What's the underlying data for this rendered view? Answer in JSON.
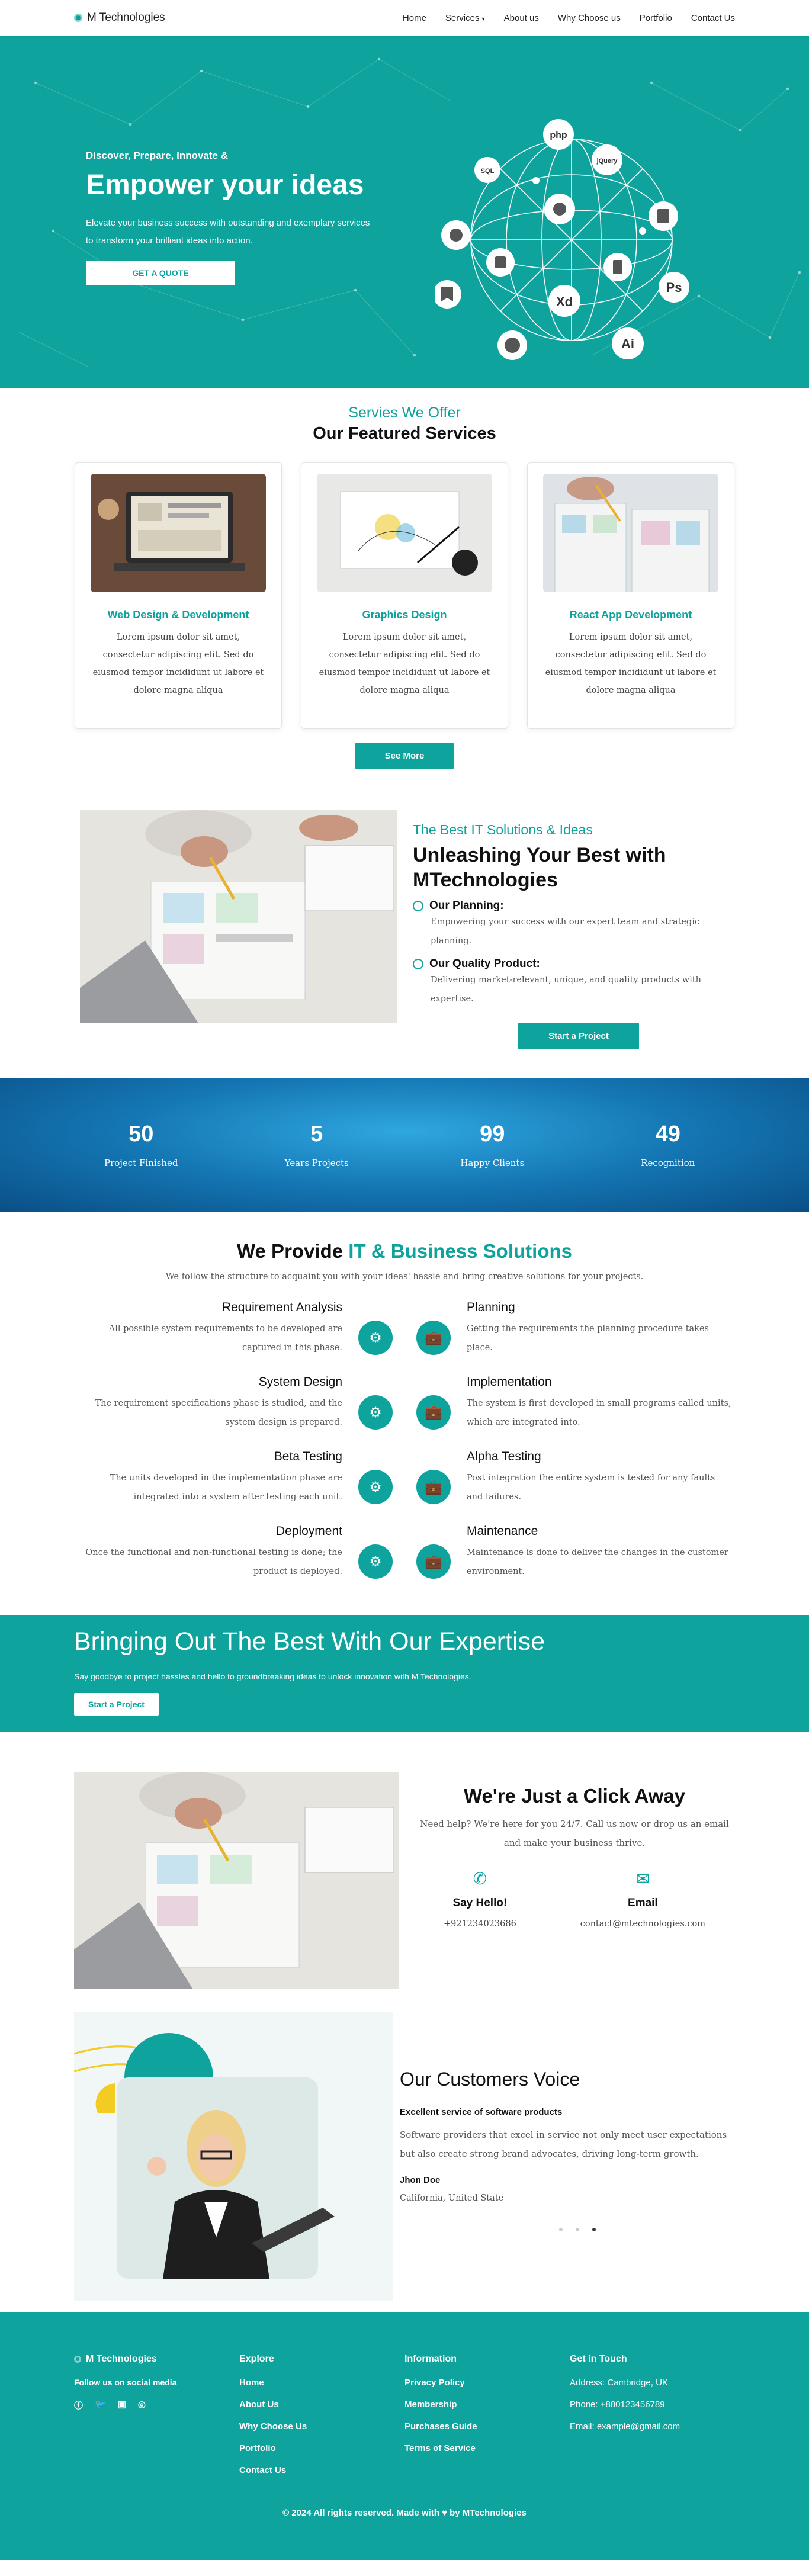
{
  "nav": {
    "brand": "M Technologies",
    "items": [
      "Home",
      "Services",
      "About us",
      "Why Choose us",
      "Portfolio",
      "Contact Us"
    ]
  },
  "hero": {
    "kicker": "Discover, Prepare, Innovate &",
    "title": "Empower your ideas",
    "desc": "Elevate your business success with outstanding and exemplary services to transform your brilliant ideas into action.",
    "cta": "GET A QUOTE",
    "tech_labels": [
      "php",
      "SQL",
      "jQuery",
      "Xd",
      "Ps",
      "Ai"
    ]
  },
  "services": {
    "kicker": "Servies We Offer",
    "title": "Our Featured Services",
    "cards": [
      {
        "title": "Web Design & Development",
        "desc": "Lorem ipsum dolor sit amet, consectetur adipiscing elit. Sed do eiusmod tempor incididunt ut labore et dolore magna aliqua"
      },
      {
        "title": "Graphics Design",
        "desc": "Lorem ipsum dolor sit amet, consectetur adipiscing elit. Sed do eiusmod tempor incididunt ut labore et dolore magna aliqua"
      },
      {
        "title": "React App Development",
        "desc": "Lorem ipsum dolor sit amet, consectetur adipiscing elit. Sed do eiusmod tempor incididunt ut labore et dolore magna aliqua"
      }
    ],
    "more": "See More"
  },
  "about": {
    "kicker": "The Best IT Solutions & Ideas",
    "title": "Unleashing Your Best with MTechnologies",
    "f1_title": "Our Planning:",
    "f1_desc": "Empowering your success with our expert team and strategic planning.",
    "f2_title": "Our Quality Product:",
    "f2_desc": "Delivering market-relevant, unique, and quality products with expertise.",
    "cta": "Start a Project"
  },
  "stats": [
    {
      "num": "50",
      "label": "Project Finished"
    },
    {
      "num": "5",
      "label": "Years Projects"
    },
    {
      "num": "99",
      "label": "Happy Clients"
    },
    {
      "num": "49",
      "label": "Recognition"
    }
  ],
  "provide": {
    "title_a": "We Provide ",
    "title_b": "IT & Business Solutions",
    "sub": "We follow the structure to acquaint you with your ideas' hassle and bring creative solutions for your projects.",
    "left": [
      {
        "title": "Requirement Analysis",
        "desc": "All possible system requirements to be developed are captured in this phase."
      },
      {
        "title": "System Design",
        "desc": "The requirement specifications phase is studied, and the system design is prepared."
      },
      {
        "title": "Beta Testing",
        "desc": "The units developed in the implementation phase are integrated into a system after testing each unit."
      },
      {
        "title": "Deployment",
        "desc": "Once the functional and non-functional testing is done; the product is deployed."
      }
    ],
    "right": [
      {
        "title": "Planning",
        "desc": "Getting the requirements the planning procedure takes place."
      },
      {
        "title": "Implementation",
        "desc": "The system is first developed in small programs called units, which are integrated into."
      },
      {
        "title": "Alpha Testing",
        "desc": "Post integration the entire system is tested for any faults and failures."
      },
      {
        "title": "Maintenance",
        "desc": "Maintenance is done to deliver the changes in the customer environment."
      }
    ]
  },
  "band": {
    "title": "Bringing Out The Best With Our Expertise",
    "desc": "Say goodbye to project hassles and hello to groundbreaking ideas to unlock innovation with M Technologies.",
    "cta": "Start a Project"
  },
  "contact": {
    "title": "We're Just a Click Away",
    "sub": "Need help? We're here for you 24/7. Call us now or drop us an email and make your business thrive.",
    "phone_label": "Say Hello!",
    "phone": "+921234023686",
    "email_label": "Email",
    "email": "contact@mtechnologies.com"
  },
  "testimonial": {
    "title": "Our Customers Voice",
    "quote_title": "Excellent service of software products",
    "quote": "Software providers that excel in service not only meet user expectations but also create strong brand advocates, driving long-term growth.",
    "name": "Jhon Doe",
    "location": "California, United State"
  },
  "footer": {
    "brand": "M Technologies",
    "follow": "Follow us on social media",
    "explore_title": "Explore",
    "explore": [
      "Home",
      "About Us",
      "Why Choose Us",
      "Portfolio",
      "Contact Us"
    ],
    "info_title": "Information",
    "info": [
      "Privacy Policy",
      "Membership",
      "Purchases Guide",
      "Terms of Service"
    ],
    "touch_title": "Get in Touch",
    "touch": [
      "Address: Cambridge, UK",
      "Phone: +880123456789",
      "Email: example@gmail.com"
    ],
    "copy_a": "© 2024 All rights reserved. Made with ",
    "copy_b": " by MTechnologies"
  },
  "colors": {
    "accent": "#0fa39e",
    "stats_blue": "#1476b3"
  }
}
